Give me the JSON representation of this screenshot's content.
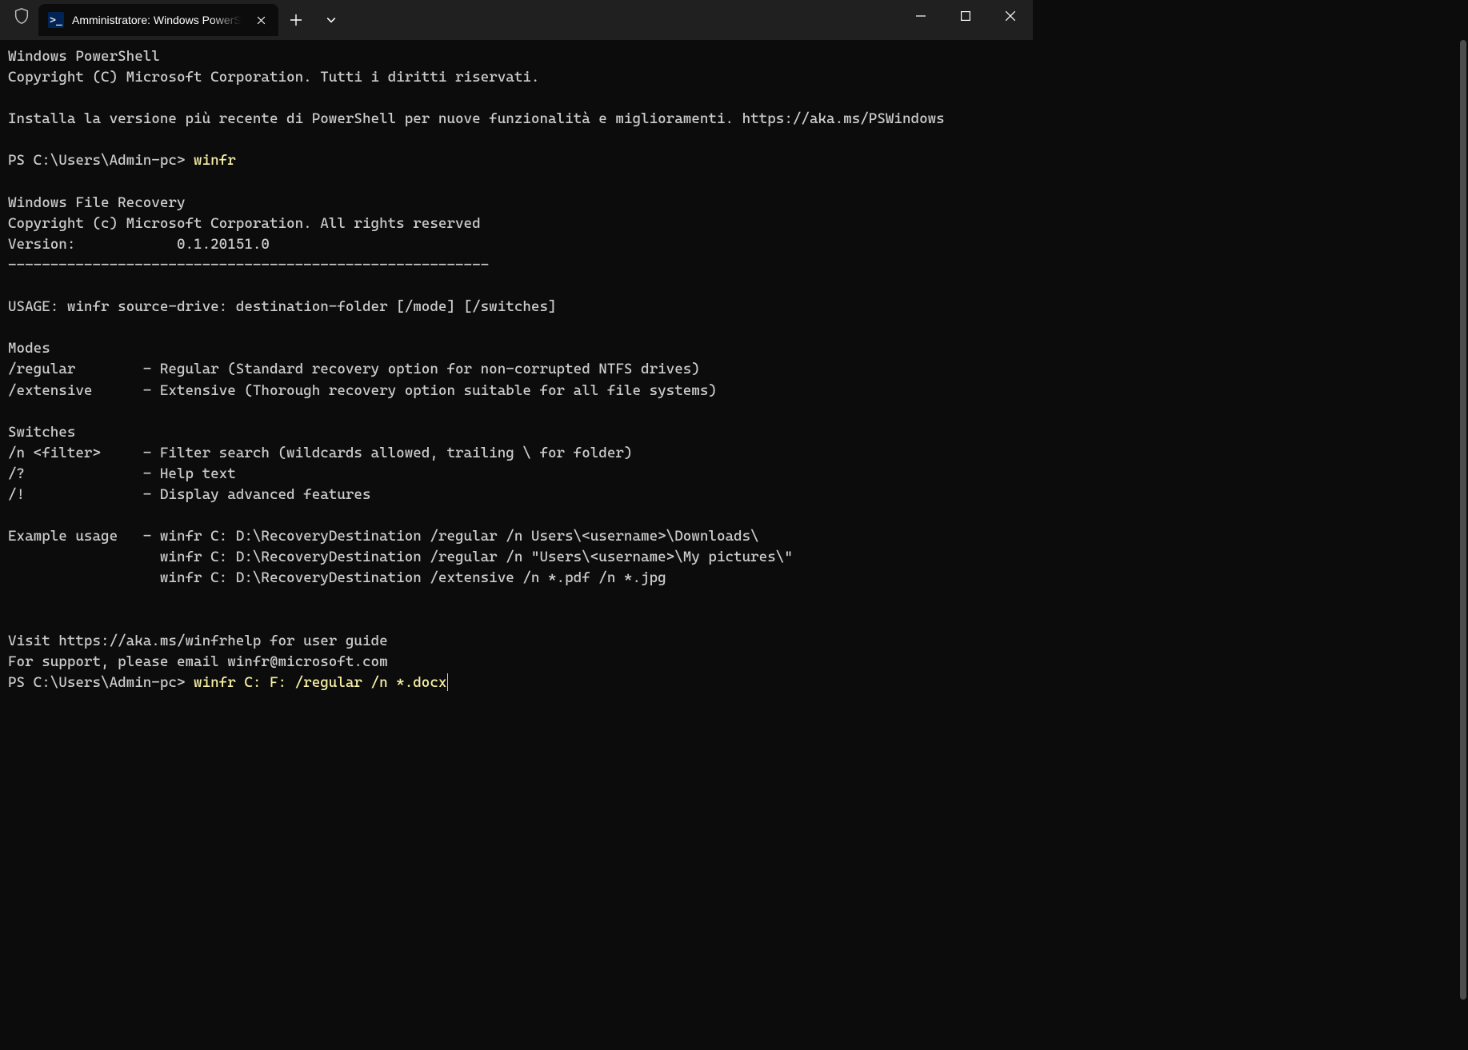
{
  "titlebar": {
    "tab_title": "Amministratore: Windows PowerShell",
    "ps_glyph": ">_"
  },
  "terminal": {
    "l1": "Windows PowerShell",
    "l2": "Copyright (C) Microsoft Corporation. Tutti i diritti riservati.",
    "l3": "",
    "l4": "Installa la versione più recente di PowerShell per nuove funzionalità e miglioramenti. https://aka.ms/PSWindows",
    "l5": "",
    "prompt1_prefix": "PS C:\\Users\\Admin-pc> ",
    "prompt1_cmd": "winfr",
    "l6": "",
    "l7": "Windows File Recovery",
    "l8": "Copyright (c) Microsoft Corporation. All rights reserved",
    "l9": "Version:            0.1.20151.0",
    "l10": "---------------------------------------------------------",
    "l11": "",
    "l12": "USAGE: winfr source-drive: destination-folder [/mode] [/switches]",
    "l13": "",
    "l14": "Modes",
    "l15": "/regular        - Regular (Standard recovery option for non-corrupted NTFS drives)",
    "l16": "/extensive      - Extensive (Thorough recovery option suitable for all file systems)",
    "l17": "",
    "l18": "Switches",
    "l19": "/n <filter>     - Filter search (wildcards allowed, trailing \\ for folder)",
    "l20": "/?              - Help text",
    "l21": "/!              - Display advanced features",
    "l22": "",
    "l23": "Example usage   - winfr C: D:\\RecoveryDestination /regular /n Users\\<username>\\Downloads\\",
    "l24": "                  winfr C: D:\\RecoveryDestination /regular /n \"Users\\<username>\\My pictures\\\"",
    "l25": "                  winfr C: D:\\RecoveryDestination /extensive /n *.pdf /n *.jpg",
    "l26": "",
    "l27": "",
    "l28": "Visit https://aka.ms/winfrhelp for user guide",
    "l29": "For support, please email winfr@microsoft.com",
    "prompt2_prefix": "PS C:\\Users\\Admin-pc> ",
    "prompt2_cmd": "winfr C: F: /regular /n *.docx"
  }
}
